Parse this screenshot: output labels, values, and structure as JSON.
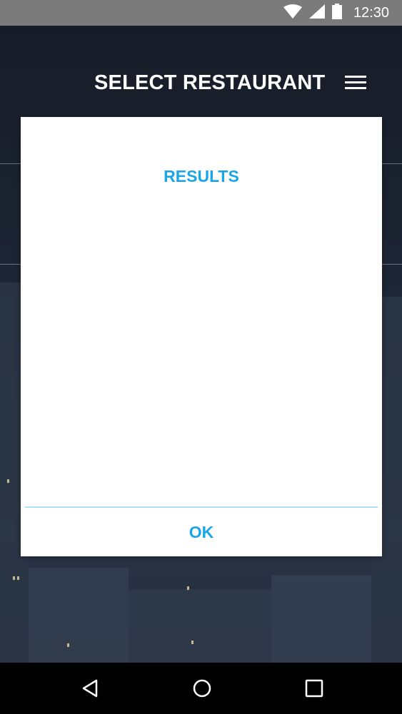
{
  "status_bar": {
    "time": "12:30",
    "icons": [
      "wifi-icon",
      "signal-icon",
      "battery-icon"
    ]
  },
  "header": {
    "title": "SELECT RESTAURANT",
    "menu_icon": "hamburger-menu-icon"
  },
  "dialog": {
    "title": "RESULTS",
    "ok_label": "OK"
  },
  "nav_bar": {
    "icons": [
      "back-icon",
      "home-icon",
      "recents-icon"
    ]
  },
  "colors": {
    "accent": "#1aa6e6",
    "divider": "#a9e3f5",
    "status_bar": "#7a7a7a",
    "nav_bar": "#000000",
    "dialog_bg": "#ffffff"
  }
}
